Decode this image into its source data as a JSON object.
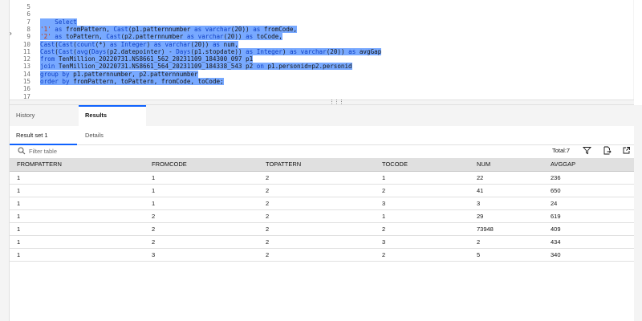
{
  "editor": {
    "line_numbers": [
      "5",
      "6",
      "7",
      "8",
      "9",
      "10",
      "11",
      "12",
      "13",
      "14",
      "15",
      "16",
      "17"
    ],
    "code": [
      [],
      [],
      [
        {
          "t": "    Select",
          "c": "kw"
        }
      ],
      [
        {
          "t": "'1'",
          "c": "st"
        },
        {
          "t": " as ",
          "c": "kw"
        },
        {
          "t": "fromPattern, "
        },
        {
          "t": "Cast",
          "c": "kw"
        },
        {
          "t": "(p1.patternnumber "
        },
        {
          "t": "as varchar",
          "c": "kw"
        },
        {
          "t": "(20)) "
        },
        {
          "t": "as",
          "c": "kw"
        },
        {
          "t": " fromCode,"
        }
      ],
      [
        {
          "t": "'2'",
          "c": "st"
        },
        {
          "t": " as ",
          "c": "kw"
        },
        {
          "t": "toPattern, "
        },
        {
          "t": "Cast",
          "c": "kw"
        },
        {
          "t": "(p2.patternnumber "
        },
        {
          "t": "as varchar",
          "c": "kw"
        },
        {
          "t": "(20)) "
        },
        {
          "t": "as",
          "c": "kw"
        },
        {
          "t": " toCode,"
        }
      ],
      [
        {
          "t": "Cast",
          "c": "kw"
        },
        {
          "t": "("
        },
        {
          "t": "Cast",
          "c": "kw"
        },
        {
          "t": "("
        },
        {
          "t": "count",
          "c": "kw"
        },
        {
          "t": "(*) "
        },
        {
          "t": "as Integer",
          "c": "kw"
        },
        {
          "t": ") "
        },
        {
          "t": "as varchar",
          "c": "kw"
        },
        {
          "t": "(20)) "
        },
        {
          "t": "as",
          "c": "kw"
        },
        {
          "t": " num,"
        }
      ],
      [
        {
          "t": "Cast",
          "c": "kw"
        },
        {
          "t": "("
        },
        {
          "t": "Cast",
          "c": "kw"
        },
        {
          "t": "("
        },
        {
          "t": "avg",
          "c": "kw"
        },
        {
          "t": "("
        },
        {
          "t": "Days",
          "c": "kw"
        },
        {
          "t": "(p2.datepointer) - "
        },
        {
          "t": "Days",
          "c": "kw"
        },
        {
          "t": "(p1.stopdate)) "
        },
        {
          "t": "as Integer",
          "c": "kw"
        },
        {
          "t": ") "
        },
        {
          "t": "as varchar",
          "c": "kw"
        },
        {
          "t": "(20)) "
        },
        {
          "t": "as",
          "c": "kw"
        },
        {
          "t": " avgGap"
        }
      ],
      [
        {
          "t": "from",
          "c": "kw"
        },
        {
          "t": " TenMillion_20220731.NS8661_562_20231109_184300_097 p1"
        }
      ],
      [
        {
          "t": "join",
          "c": "kw"
        },
        {
          "t": " TenMillion_20220731.NS8661_564_20231109_184338_543 p2 "
        },
        {
          "t": "on",
          "c": "kw"
        },
        {
          "t": " p1.personid=p2.personid"
        }
      ],
      [
        {
          "t": "group by",
          "c": "kw"
        },
        {
          "t": " p1.patternnumber, p2.patternnumber"
        }
      ],
      [
        {
          "t": "order by",
          "c": "kw"
        },
        {
          "t": " fromPattern, toPattern, fromCode, toCode;"
        }
      ],
      [],
      []
    ],
    "selected_lines": [
      2,
      3,
      4,
      5,
      6,
      7,
      8,
      9,
      10
    ]
  },
  "tabs": {
    "history": "History",
    "results": "Results",
    "result_set": "Result set 1",
    "details": "Details"
  },
  "toolbar": {
    "filter_placeholder": "Filter table",
    "total": "Total:7"
  },
  "table": {
    "columns": [
      "FROMPATTERN",
      "FROMCODE",
      "TOPATTERN",
      "TOCODE",
      "NUM",
      "AVGGAP"
    ],
    "rows": [
      [
        "1",
        "1",
        "2",
        "1",
        "22",
        "236"
      ],
      [
        "1",
        "1",
        "2",
        "2",
        "41",
        "650"
      ],
      [
        "1",
        "1",
        "2",
        "3",
        "3",
        "24"
      ],
      [
        "1",
        "2",
        "2",
        "1",
        "29",
        "619"
      ],
      [
        "1",
        "2",
        "2",
        "2",
        "73948",
        "409"
      ],
      [
        "1",
        "2",
        "2",
        "3",
        "2",
        "434"
      ],
      [
        "1",
        "3",
        "2",
        "2",
        "5",
        "340"
      ]
    ]
  },
  "colors": {
    "selection": "#78a9ff",
    "keyword": "#0f3fc4",
    "string": "#c23a0a",
    "accent": "#0f62fe"
  },
  "icons": [
    "search-icon",
    "funnel-icon",
    "export-icon",
    "expand-icon",
    "grip-icon",
    "arrow-up-icon",
    "arrow-down-icon"
  ]
}
